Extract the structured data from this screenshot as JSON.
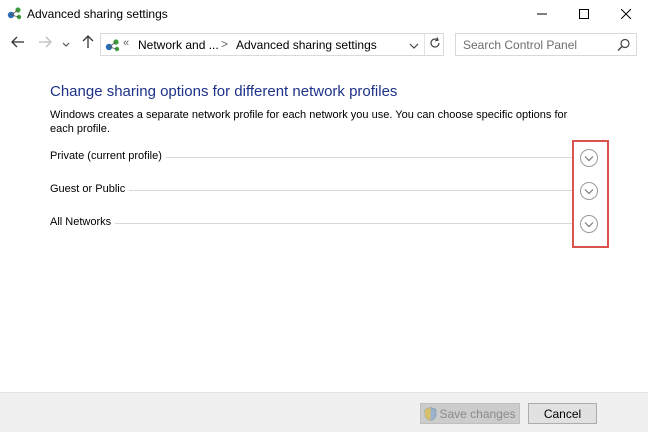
{
  "window": {
    "title": "Advanced sharing settings",
    "app_icon": "network-sharing-icon",
    "controls": [
      "minimize-icon",
      "maximize-icon",
      "close-icon"
    ]
  },
  "nav": {
    "back_icon": "arrow-left-icon",
    "forward_icon": "arrow-right-icon",
    "recent_icon": "chevron-down-icon",
    "up_icon": "arrow-up-icon"
  },
  "address": {
    "overflow": "«",
    "crumbs": [
      "Network and ...",
      "Advanced sharing settings"
    ],
    "separator": ">",
    "dropdown_icon": "chevron-down-icon",
    "refresh_icon": "refresh-icon"
  },
  "search": {
    "placeholder": "Search Control Panel",
    "value": "",
    "icon": "search-icon"
  },
  "main": {
    "heading": "Change sharing options for different network profiles",
    "description": "Windows creates a separate network profile for each network you use. You can choose specific options for each profile.",
    "profiles": [
      {
        "label": "Private (current profile)",
        "expanded": false
      },
      {
        "label": "Guest or Public",
        "expanded": false
      },
      {
        "label": "All Networks",
        "expanded": false
      }
    ],
    "expand_icon": "expand-chevron-circle-icon",
    "highlight_color": "#d9534f",
    "heading_color": "#1e3287"
  },
  "footer": {
    "save_label": "Save changes",
    "save_enabled": false,
    "save_icon": "uac-shield-icon",
    "cancel_label": "Cancel"
  }
}
